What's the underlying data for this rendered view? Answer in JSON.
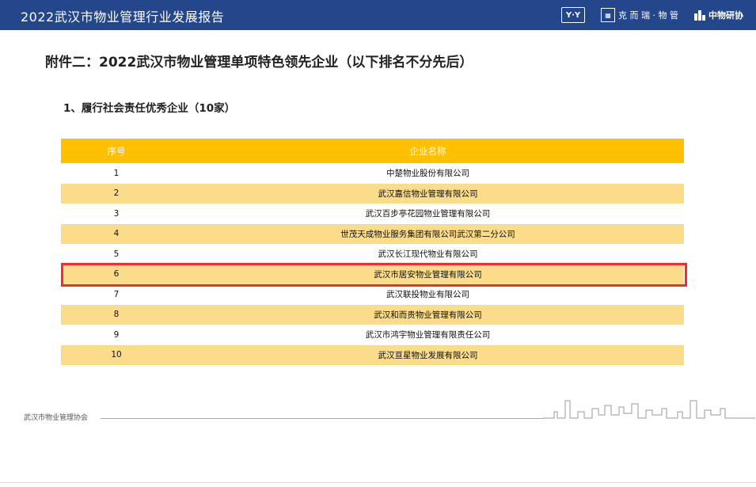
{
  "header": {
    "title": "2022武汉市物业管理行业发展报告",
    "logos": [
      {
        "name": "yy-logo",
        "text": "Y·Y"
      },
      {
        "name": "kerui-logo",
        "text": "克 而 瑞 · 物 管"
      },
      {
        "name": "zhongwu-logo",
        "text": "中物研协"
      }
    ]
  },
  "main_title": "附件二：2022武汉市物业管理单项特色领先企业（以下排名不分先后）",
  "sub_title": "1、履行社会责任优秀企业（10家）",
  "table": {
    "headers": [
      "序号",
      "企业名称"
    ],
    "rows": [
      {
        "num": "1",
        "name": "中楚物业股份有限公司"
      },
      {
        "num": "2",
        "name": "武汉嘉信物业管理有限公司"
      },
      {
        "num": "3",
        "name": "武汉百步亭花园物业管理有限公司"
      },
      {
        "num": "4",
        "name": "世茂天成物业服务集团有限公司武汉第二分公司"
      },
      {
        "num": "5",
        "name": "武汉长江现代物业有限公司"
      },
      {
        "num": "6",
        "name": "武汉市居安物业管理有限公司"
      },
      {
        "num": "7",
        "name": "武汉联投物业有限公司"
      },
      {
        "num": "8",
        "name": "武汉和而贵物业管理有限公司"
      },
      {
        "num": "9",
        "name": "武汉市鸿宇物业管理有限责任公司"
      },
      {
        "num": "10",
        "name": "武汉亘星物业发展有限公司"
      }
    ],
    "highlighted_row": 6
  },
  "footer": {
    "text": "武汉市物业管理协会"
  },
  "colors": {
    "header_bg": "#23478a",
    "table_header": "#ffc000",
    "stripe": "#fbdc8b",
    "highlight": "#ee2f2f"
  }
}
